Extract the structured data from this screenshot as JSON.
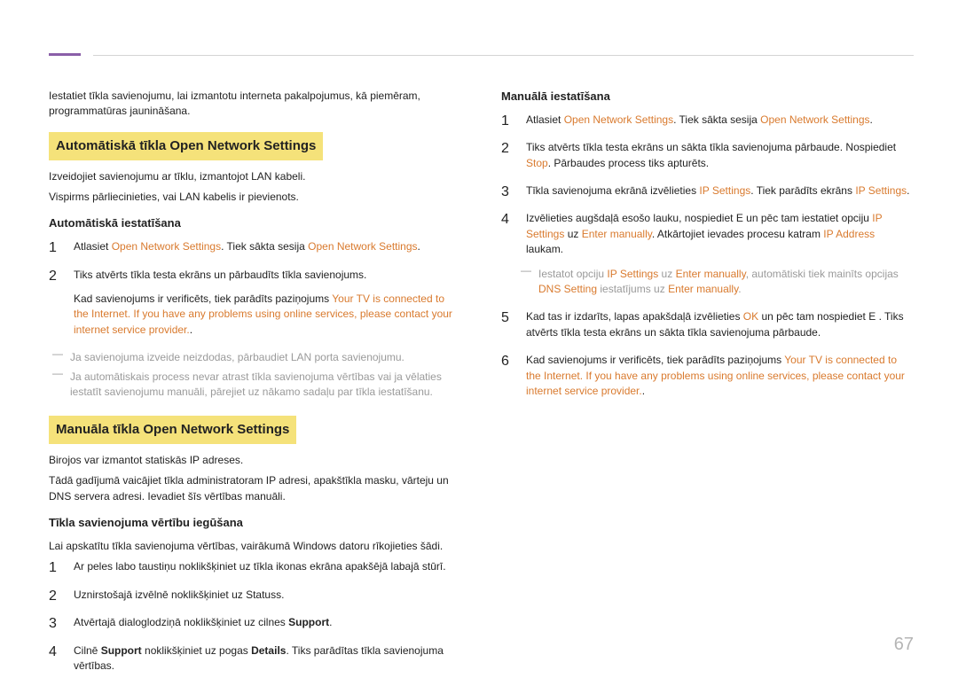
{
  "pageNumber": "67",
  "left": {
    "intro": "Iestatiet tīkla savienojumu, lai izmantotu interneta pakalpojumus, kā piemēram, programmatūras jaunināšana.",
    "heading1": "Automātiskā tīkla Open Network Settings",
    "h1_p1": "Izveidojiet savienojumu ar tīklu, izmantojot LAN kabeli.",
    "h1_p2": "Vispirms pārliecinieties, vai LAN kabelis ir pievienots.",
    "sub1": "Automātiskā iestatīšana",
    "s1_li1_pre": "Atlasiet ",
    "s1_li1_link1": "Open Network Settings",
    "s1_li1_mid": ". Tiek sākta sesija ",
    "s1_li1_link2": "Open Network Settings",
    "s1_li1_post": ".",
    "s1_li2_text": "Tiks atvērts tīkla testa ekrāns un pārbaudīts tīkla savienojums.",
    "s1_li2_inset_pre": "Kad savienojums ir verificēts, tiek parādīts paziņojums ",
    "s1_li2_inset_orange": "Your TV is connected to the Internet. If you have any problems using online services, please contact your internet service provider.",
    "s1_li2_inset_post": ".",
    "s1_note1": "Ja savienojuma izveide neizdodas, pārbaudiet LAN porta savienojumu.",
    "s1_note2": "Ja automātiskais process nevar atrast tīkla savienojuma vērtības vai ja vēlaties iestatīt savienojumu manuāli, pārejiet uz nākamo sadaļu par tīkla iestatīšanu.",
    "heading2": "Manuāla tīkla Open Network Settings",
    "h2_p1": "Birojos var izmantot statiskās IP adreses.",
    "h2_p2": "Tādā gadījumā vaicājiet tīkla administratoram IP adresi, apakštīkla masku, vārteju un DNS servera adresi. Ievadiet šīs vērtības manuāli.",
    "sub2": "Tīkla savienojuma vērtību iegūšana",
    "s2_intro": "Lai apskatītu tīkla savienojuma vērtības, vairākumā Windows datoru rīkojieties šādi.",
    "s2_li1": "Ar peles labo taustiņu noklikšķiniet uz tīkla ikonas ekrāna apakšējā labajā stūrī.",
    "s2_li2": "Uznirstošajā izvēlnē noklikšķiniet uz Statuss.",
    "s2_li3_pre": "Atvērtajā dialoglodziņā noklikšķiniet uz cilnes ",
    "s2_li3_b": "Support",
    "s2_li3_post": ".",
    "s2_li4_pre": "Cilnē ",
    "s2_li4_b1": "Support",
    "s2_li4_mid": " noklikšķiniet uz pogas ",
    "s2_li4_b2": "Details",
    "s2_li4_post": ". Tiks parādītas tīkla savienojuma vērtības."
  },
  "right": {
    "sub1": "Manuālā iestatīšana",
    "li1_pre": "Atlasiet ",
    "li1_link1": "Open Network Settings",
    "li1_mid": ". Tiek sākta sesija ",
    "li1_link2": "Open Network Settings",
    "li1_post": ".",
    "li2_pre": "Tiks atvērts tīkla testa ekrāns un sākta tīkla savienojuma pārbaude. Nospiediet ",
    "li2_link": "Stop",
    "li2_post": ". Pārbaudes process tiks apturēts.",
    "li3_pre": "Tīkla savienojuma ekrānā izvēlieties ",
    "li3_link1": "IP Settings",
    "li3_mid": ". Tiek parādīts ekrāns ",
    "li3_link2": "IP Settings",
    "li3_post": ".",
    "li4_pre": "Izvēlieties augšdaļā esošo lauku, nospiediet ",
    "li4_icon": "E",
    "li4_mid": "   un pēc tam iestatiet opciju ",
    "li4_link1": "IP Settings",
    "li4_mid2": " uz ",
    "li4_link2": "Enter manually",
    "li4_mid3": ". Atkārtojiet ievades procesu katram ",
    "li4_link3": "IP Address",
    "li4_post": " laukam.",
    "li4_note_pre": "Iestatot opciju ",
    "li4_note_l1": "IP Settings",
    "li4_note_m1": " uz ",
    "li4_note_l2": "Enter manually",
    "li4_note_m2": ", automātiski tiek mainīts opcijas ",
    "li4_note_l3": "DNS Setting",
    "li4_note_m3": " iestatījums uz ",
    "li4_note_l4": "Enter manually",
    "li4_note_post": ".",
    "li5_pre": "Kad tas ir izdarīts, lapas apakšdaļā izvēlieties ",
    "li5_link": "OK",
    "li5_mid": " un pēc tam nospiediet ",
    "li5_icon": "E",
    "li5_post": "  . Tiks atvērts tīkla testa ekrāns un sākta tīkla savienojuma pārbaude.",
    "li6_pre": "Kad savienojums ir verificēts, tiek parādīts paziņojums ",
    "li6_orange": "Your TV is connected to the Internet. If you have any problems using online services, please contact your internet service provider.",
    "li6_post": "."
  }
}
